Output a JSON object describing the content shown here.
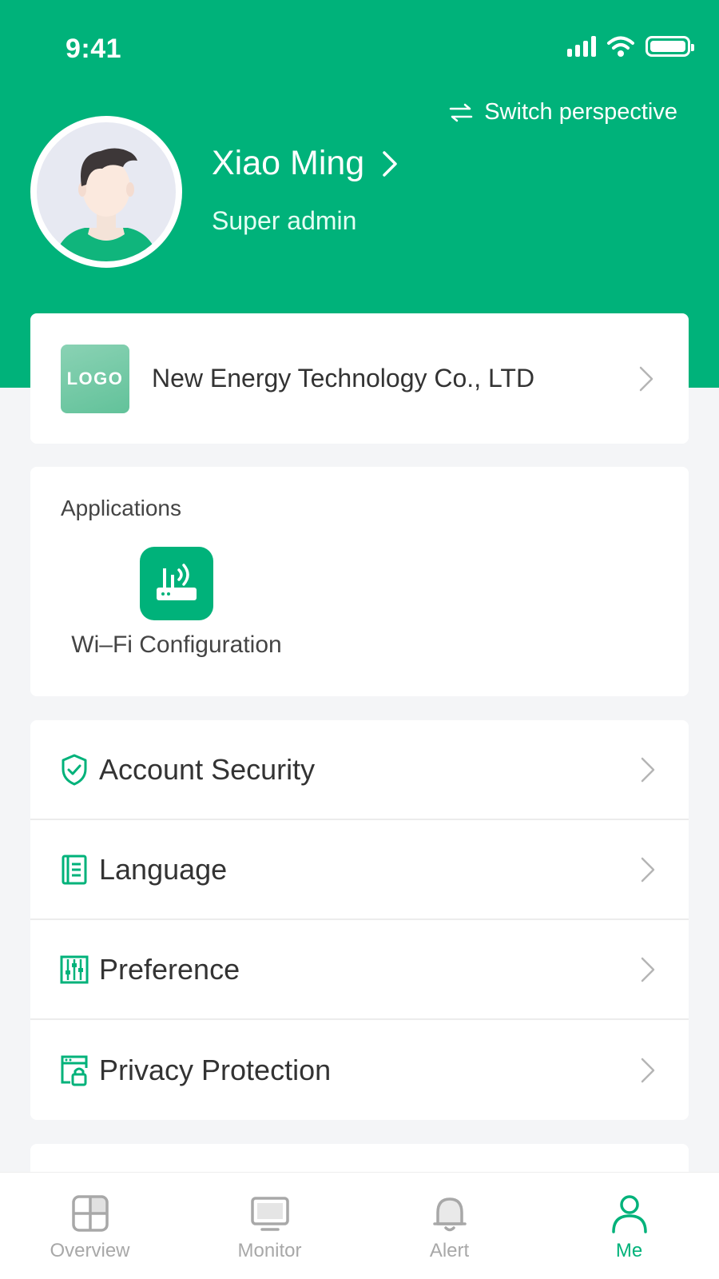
{
  "status": {
    "time": "9:41"
  },
  "header": {
    "switch_label": "Switch perspective",
    "user_name": "Xiao Ming",
    "user_role": "Super admin"
  },
  "company": {
    "logo_text": "LOGO",
    "name": "New Energy Technology Co., LTD"
  },
  "applications": {
    "title": "Applications",
    "items": [
      {
        "label": "Wi–Fi Configuration",
        "icon": "router-wifi-icon"
      }
    ]
  },
  "settings": {
    "items": [
      {
        "label": "Account Security",
        "icon": "shield-check-icon"
      },
      {
        "label": "Language",
        "icon": "book-icon"
      },
      {
        "label": "Preference",
        "icon": "sliders-icon"
      },
      {
        "label": "Privacy Protection",
        "icon": "lock-window-icon"
      }
    ]
  },
  "tabs": [
    {
      "label": "Overview",
      "icon": "overview-icon",
      "active": false
    },
    {
      "label": "Monitor",
      "icon": "monitor-icon",
      "active": false
    },
    {
      "label": "Alert",
      "icon": "bell-icon",
      "active": false
    },
    {
      "label": "Me",
      "icon": "person-icon",
      "active": true
    }
  ],
  "colors": {
    "brand": "#00b27a",
    "background": "#f4f5f7",
    "inactive_tab": "#a8a8a8"
  }
}
